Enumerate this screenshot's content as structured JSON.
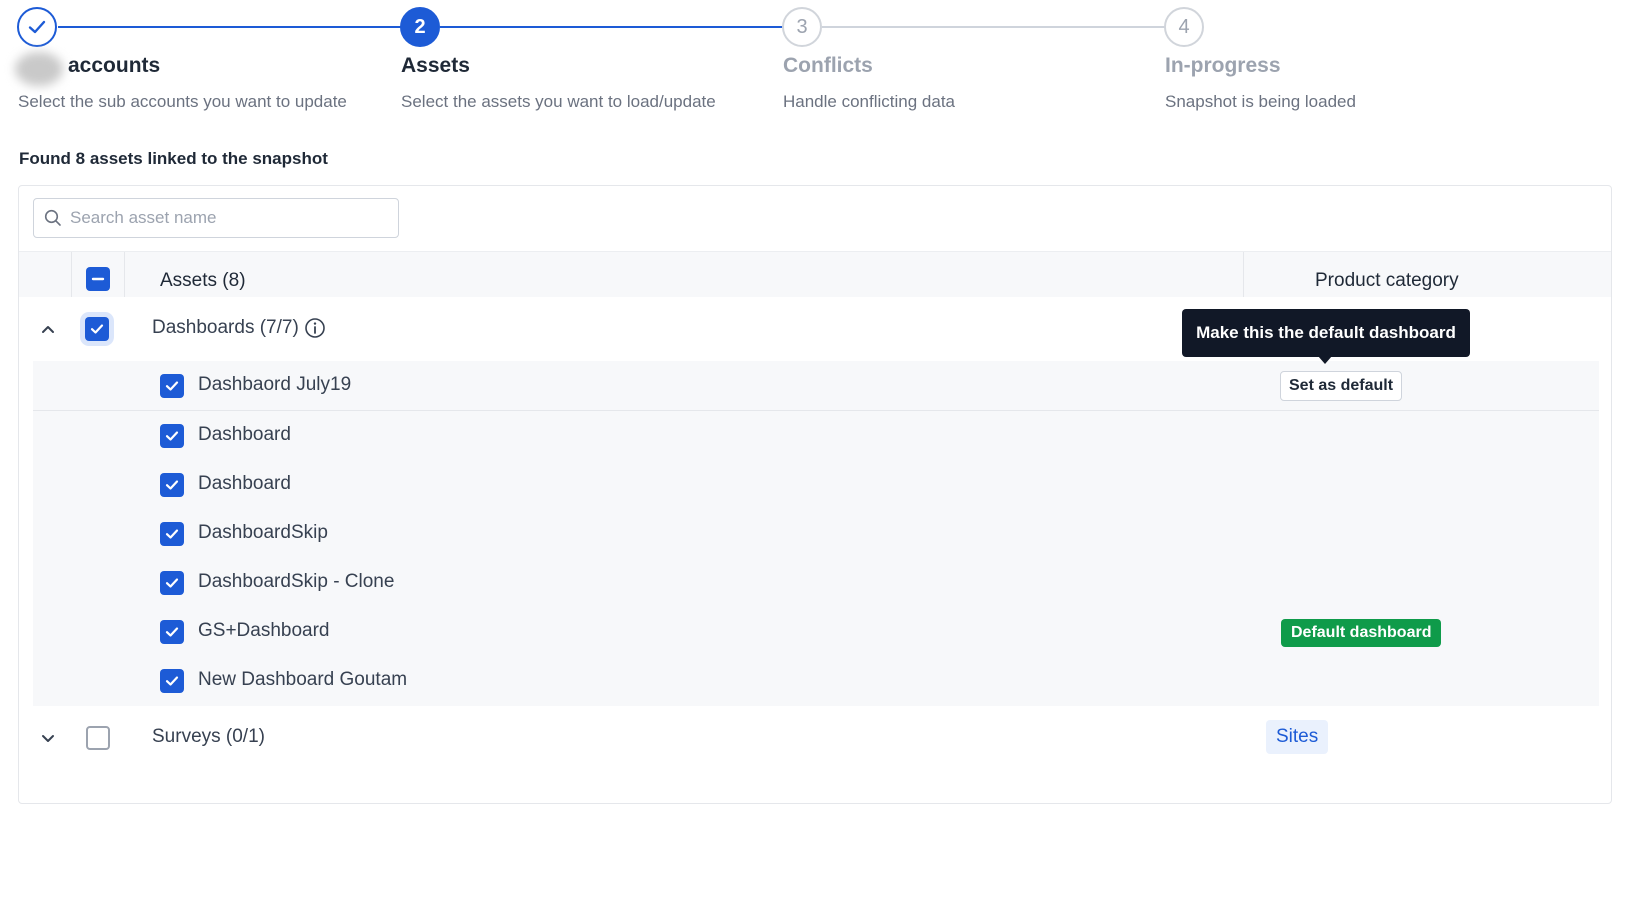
{
  "stepper": {
    "steps": [
      {
        "number": "",
        "title": "accounts",
        "description": "Select the sub accounts you want to update",
        "state": "complete"
      },
      {
        "number": "2",
        "title": "Assets",
        "description": "Select the assets you want to load/update",
        "state": "active"
      },
      {
        "number": "3",
        "title": "Conflicts",
        "description": "Handle conflicting data",
        "state": "pending"
      },
      {
        "number": "4",
        "title": "In-progress",
        "description": "Snapshot is being loaded",
        "state": "pending"
      }
    ]
  },
  "summary": {
    "found_text": "Found 8 assets linked to the snapshot"
  },
  "search": {
    "placeholder": "Search asset name",
    "value": ""
  },
  "table": {
    "headers": {
      "assets": "Assets (8)",
      "product_category": "Product category"
    },
    "groups": [
      {
        "label": "Dashboards (7/7)",
        "expanded": true,
        "checked": true,
        "items": [
          {
            "label": "Dashbaord July19",
            "checked": true,
            "action": "Set as default"
          },
          {
            "label": "Dashboard",
            "checked": true
          },
          {
            "label": "Dashboard",
            "checked": true
          },
          {
            "label": "DashboardSkip",
            "checked": true
          },
          {
            "label": "DashboardSkip - Clone",
            "checked": true
          },
          {
            "label": "GS+Dashboard",
            "checked": true,
            "badge": "Default dashboard"
          },
          {
            "label": "New Dashboard Goutam",
            "checked": true
          }
        ]
      },
      {
        "label": "Surveys (0/1)",
        "expanded": false,
        "checked": false,
        "category": "Sites"
      }
    ]
  },
  "tooltip": {
    "text": "Make this the default dashboard"
  },
  "colors": {
    "primary": "#1d5bd6",
    "success": "#0f9b4a",
    "tooltip_bg": "#111827"
  },
  "icons": {
    "complete_step": "check-icon",
    "search": "search-icon",
    "info": "info-icon",
    "expanded": "chevron-up-icon",
    "collapsed": "chevron-down-icon"
  }
}
